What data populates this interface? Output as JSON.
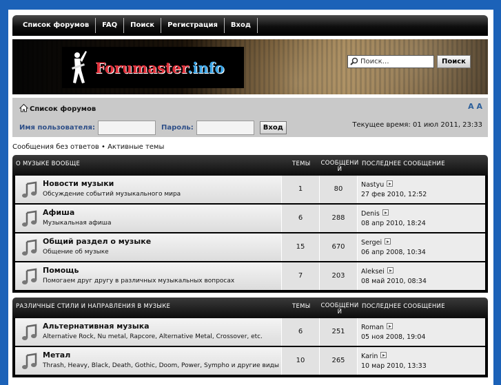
{
  "nav": {
    "items": [
      "Список форумов",
      "FAQ",
      "Поиск",
      "Регистрация",
      "Вход"
    ]
  },
  "header": {
    "logo_main": "Forumaster",
    "logo_suffix": ".info",
    "search_placeholder": "Поиск…",
    "search_button": "Поиск"
  },
  "panel": {
    "breadcrumb": "Список форумов",
    "font_resize": "A A",
    "username_label": "Имя пользователя:",
    "password_label": "Пароль:",
    "login_button": "Вход",
    "current_time": "Текущее время: 01 июл 2011, 23:33"
  },
  "quick_links": "Сообщения без ответов • Активные темы",
  "categories": [
    {
      "title": "О МУЗЫКЕ ВООБЩЕ",
      "col_topics": "ТЕМЫ",
      "col_posts_1": "СООБЩЕНИ",
      "col_posts_2": "Й",
      "col_last": "ПОСЛЕДНЕЕ СООБЩЕНИЕ",
      "forums": [
        {
          "title": "Новости музыки",
          "desc": "Обсуждение событий музыкального мира",
          "topics": "1",
          "posts": "80",
          "last_user": "Nastyu",
          "last_date": "27 фев 2010, 12:52"
        },
        {
          "title": "Афиша",
          "desc": "Музыкальная афиша",
          "topics": "6",
          "posts": "288",
          "last_user": "Denis",
          "last_date": "08 апр 2010, 18:24"
        },
        {
          "title": "Общий раздел о музыке",
          "desc": "Общение об музыке",
          "topics": "15",
          "posts": "670",
          "last_user": "Sergei",
          "last_date": "06 апр 2008, 10:34"
        },
        {
          "title": "Помощь",
          "desc": "Помогаем друг другу в различных музыкальных вопросах",
          "topics": "7",
          "posts": "203",
          "last_user": "Aleksei",
          "last_date": "08 май 2010, 08:34"
        }
      ]
    },
    {
      "title": "РАЗЛИЧНЫЕ СТИЛИ И НАПРАВЛЕНИЯ В МУЗЫКЕ",
      "col_topics": "ТЕМЫ",
      "col_posts_1": "СООБЩЕНИ",
      "col_posts_2": "Й",
      "col_last": "ПОСЛЕДНЕЕ СООБЩЕНИЕ",
      "forums": [
        {
          "title": "Альтернативная музыка",
          "desc": "Alternative Rock, Nu metal, Rapcore, Alternative Metal, Crossover, etc.",
          "topics": "6",
          "posts": "251",
          "last_user": "Roman",
          "last_date": "05 ноя 2008, 19:04"
        },
        {
          "title": "Метал",
          "desc": "Thrash, Heavy, Black, Death, Gothic, Doom, Power, Sympho и другие виды",
          "topics": "10",
          "posts": "265",
          "last_user": "Karin",
          "last_date": "10 мар 2010, 13:33"
        }
      ]
    }
  ]
}
